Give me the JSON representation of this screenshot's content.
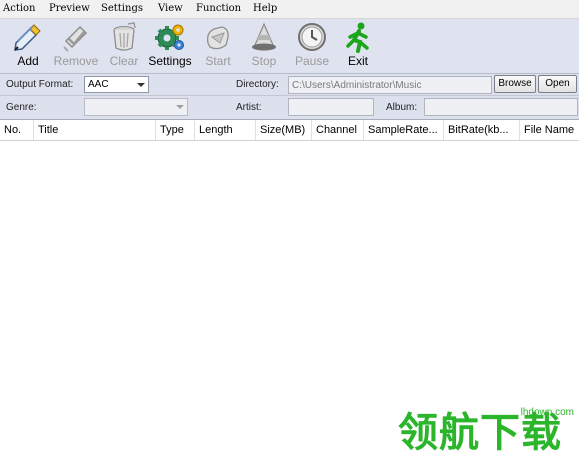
{
  "menu": {
    "items": [
      "Action",
      "Preview",
      "Settings",
      "View",
      "Function",
      "Help"
    ]
  },
  "toolbar": {
    "buttons": [
      {
        "label": "Add",
        "icon": "add-pencil-icon",
        "enabled": true
      },
      {
        "label": "Remove",
        "icon": "remove-icon",
        "enabled": false
      },
      {
        "label": "Clear",
        "icon": "clear-bin-icon",
        "enabled": false
      },
      {
        "label": "Settings",
        "icon": "settings-gear-icon",
        "enabled": true
      },
      {
        "label": "Start",
        "icon": "start-icon",
        "enabled": false
      },
      {
        "label": "Stop",
        "icon": "stop-cone-icon",
        "enabled": false
      },
      {
        "label": "Pause",
        "icon": "pause-clock-icon",
        "enabled": false
      },
      {
        "label": "Exit",
        "icon": "exit-runner-icon",
        "enabled": true
      }
    ]
  },
  "options": {
    "output_format_label": "Output Format:",
    "output_format_value": "AAC",
    "directory_label": "Directory:",
    "directory_value": "C:\\Users\\Administrator\\Music",
    "browse_label": "Browse",
    "open_label": "Open",
    "genre_label": "Genre:",
    "genre_value": "",
    "artist_label": "Artist:",
    "artist_value": "",
    "album_label": "Album:",
    "album_value": ""
  },
  "table": {
    "columns": [
      "No.",
      "Title",
      "Type",
      "Length",
      "Size(MB)",
      "Channel",
      "SampleRate...",
      "BitRate(kb...",
      "File Name"
    ],
    "rows": []
  },
  "watermark": {
    "site": "lhdown.com",
    "text": "领航下载"
  },
  "colors": {
    "toolbar_bg": "#dfe3ef",
    "watermark_green": "#2bb52b",
    "exit_green": "#1aa51a"
  }
}
